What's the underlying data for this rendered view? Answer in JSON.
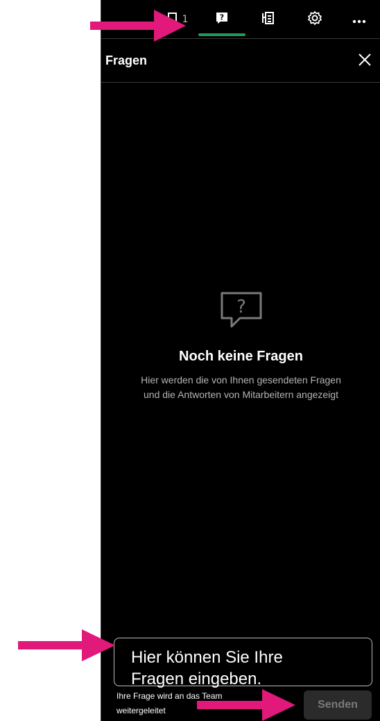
{
  "toolbar": {
    "participants_count": "1",
    "items": [
      {
        "icon": "participants-icon"
      },
      {
        "icon": "questions-icon"
      },
      {
        "icon": "notes-icon"
      },
      {
        "icon": "settings-icon"
      },
      {
        "icon": "more-icon"
      }
    ],
    "active_color": "#1f9d55"
  },
  "header": {
    "title": "Fragen",
    "close_icon": "close-icon"
  },
  "empty_state": {
    "icon": "question-bubble-icon",
    "title": "Noch keine Fragen",
    "description_line1": "Hier werden die von Ihnen gesendeten Fragen",
    "description_line2": "und die Antworten von Mitarbeitern angezeigt"
  },
  "composer": {
    "input_text": "Hier können Sie Ihre Fragen eingeben.",
    "hint_line1": "Ihre Frage wird an das Team",
    "hint_line2": "weitergeleitet",
    "send_label": "Senden"
  },
  "annotations": {
    "arrow_color": "#e0197a"
  }
}
